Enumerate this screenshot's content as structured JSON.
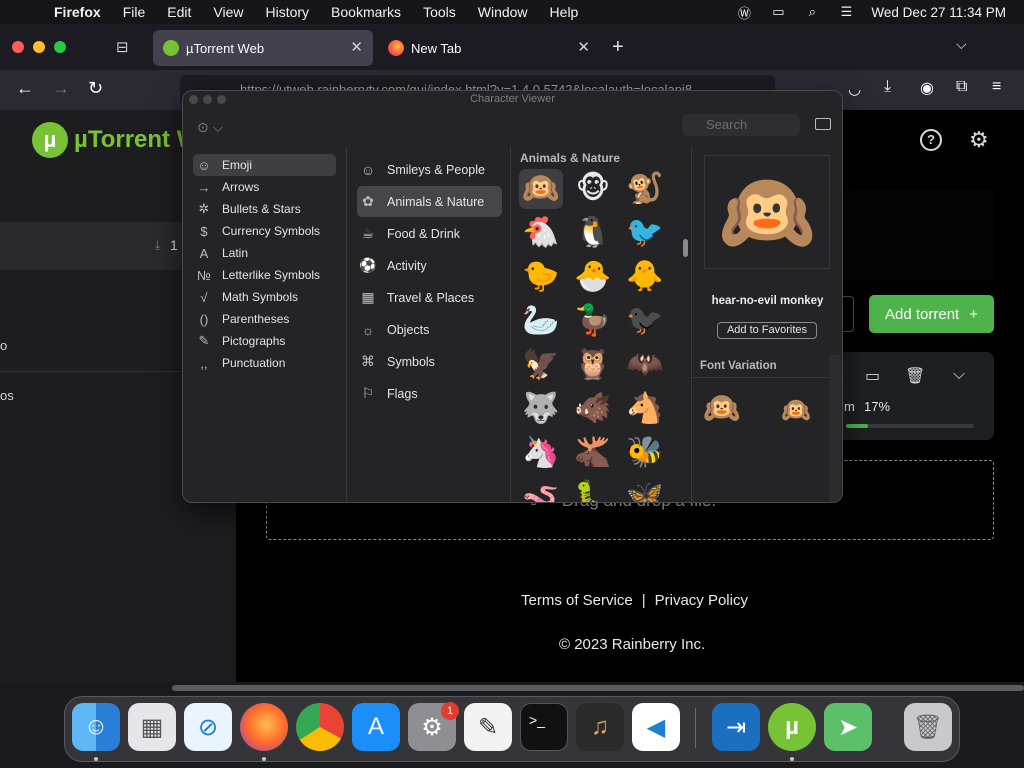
{
  "menubar": {
    "app_name": "Firefox",
    "items": [
      "File",
      "Edit",
      "View",
      "History",
      "Bookmarks",
      "Tools",
      "Window",
      "Help"
    ],
    "datetime": "Wed Dec 27  11:34 PM"
  },
  "browser": {
    "tabs": [
      {
        "title": "µTorrent Web",
        "active": true
      },
      {
        "title": "New Tab",
        "active": false
      }
    ],
    "url": "https://utweb.rainberrytv.com/gui/index.html?v=1.4.0.5742&localauth=localapi8..."
  },
  "page": {
    "logo_text": "µTorrent W",
    "sidebar_count": "1",
    "sidebar_frag_1": "o",
    "sidebar_frag_2": "os",
    "add_torrent_label": "Add torrent",
    "torrent_progress": "17%",
    "torrent_progress_value": 17,
    "torrent_fragment": "m",
    "drop_text": "Drag and drop a file.",
    "footer": {
      "terms": "Terms of Service",
      "separator": "|",
      "privacy": "Privacy Policy",
      "copyright": "© 2023 Rainberry Inc."
    }
  },
  "character_viewer": {
    "title": "Character Viewer",
    "search_placeholder": "Search",
    "categories": [
      {
        "label": "Emoji",
        "icon": "☺",
        "selected": true
      },
      {
        "label": "Arrows",
        "icon": "→",
        "selected": false
      },
      {
        "label": "Bullets & Stars",
        "icon": "✲",
        "selected": false
      },
      {
        "label": "Currency Symbols",
        "icon": "$",
        "selected": false
      },
      {
        "label": "Latin",
        "icon": "A",
        "selected": false
      },
      {
        "label": "Letterlike Symbols",
        "icon": "№",
        "selected": false
      },
      {
        "label": "Math Symbols",
        "icon": "√",
        "selected": false
      },
      {
        "label": "Parentheses",
        "icon": "()",
        "selected": false
      },
      {
        "label": "Pictographs",
        "icon": "✎",
        "selected": false
      },
      {
        "label": "Punctuation",
        "icon": ",,",
        "selected": false
      }
    ],
    "subcategories": [
      {
        "label": "Smileys & People",
        "icon": "☺",
        "selected": false
      },
      {
        "label": "Animals & Nature",
        "icon": "✿",
        "selected": true
      },
      {
        "label": "Food & Drink",
        "icon": "☕",
        "selected": false
      },
      {
        "label": "Activity",
        "icon": "⚽",
        "selected": false
      },
      {
        "label": "Travel & Places",
        "icon": "▦",
        "selected": false
      },
      {
        "label": "Objects",
        "icon": "☼",
        "selected": false
      },
      {
        "label": "Symbols",
        "icon": "⌘",
        "selected": false
      },
      {
        "label": "Flags",
        "icon": "⚐",
        "selected": false
      }
    ],
    "section_heading": "Animals & Nature",
    "emojis": [
      [
        "🙉",
        "🐵",
        "🐒"
      ],
      [
        "🐔",
        "🐧",
        "🐦"
      ],
      [
        "🐤",
        "🐣",
        "🐥"
      ],
      [
        "🦢",
        "🦆",
        "🐦‍⬛"
      ],
      [
        "🦅",
        "🦉",
        "🦇"
      ],
      [
        "🐺",
        "🐗",
        "🐴"
      ],
      [
        "🦄",
        "🫎",
        "🐝"
      ],
      [
        "🪱",
        "🐛",
        "🦋"
      ]
    ],
    "selected_emoji": "🙉",
    "selected_name": "hear-no-evil monkey",
    "add_favorites_label": "Add to Favorites",
    "font_variation_title": "Font Variation",
    "font_variations": [
      "🙉",
      "🙉"
    ]
  },
  "dock": {
    "apps": [
      "Finder",
      "Launchpad",
      "Safari",
      "Firefox",
      "Chrome",
      "App Store",
      "System Settings",
      "TextEdit",
      "Terminal",
      "GarageBand",
      "VS Code",
      "Migration",
      "µTorrent",
      "Maps",
      "Trash"
    ],
    "settings_badge": "1"
  },
  "colors": {
    "accent_green": "#4db34a",
    "utorrent_logo": "#78c335"
  }
}
